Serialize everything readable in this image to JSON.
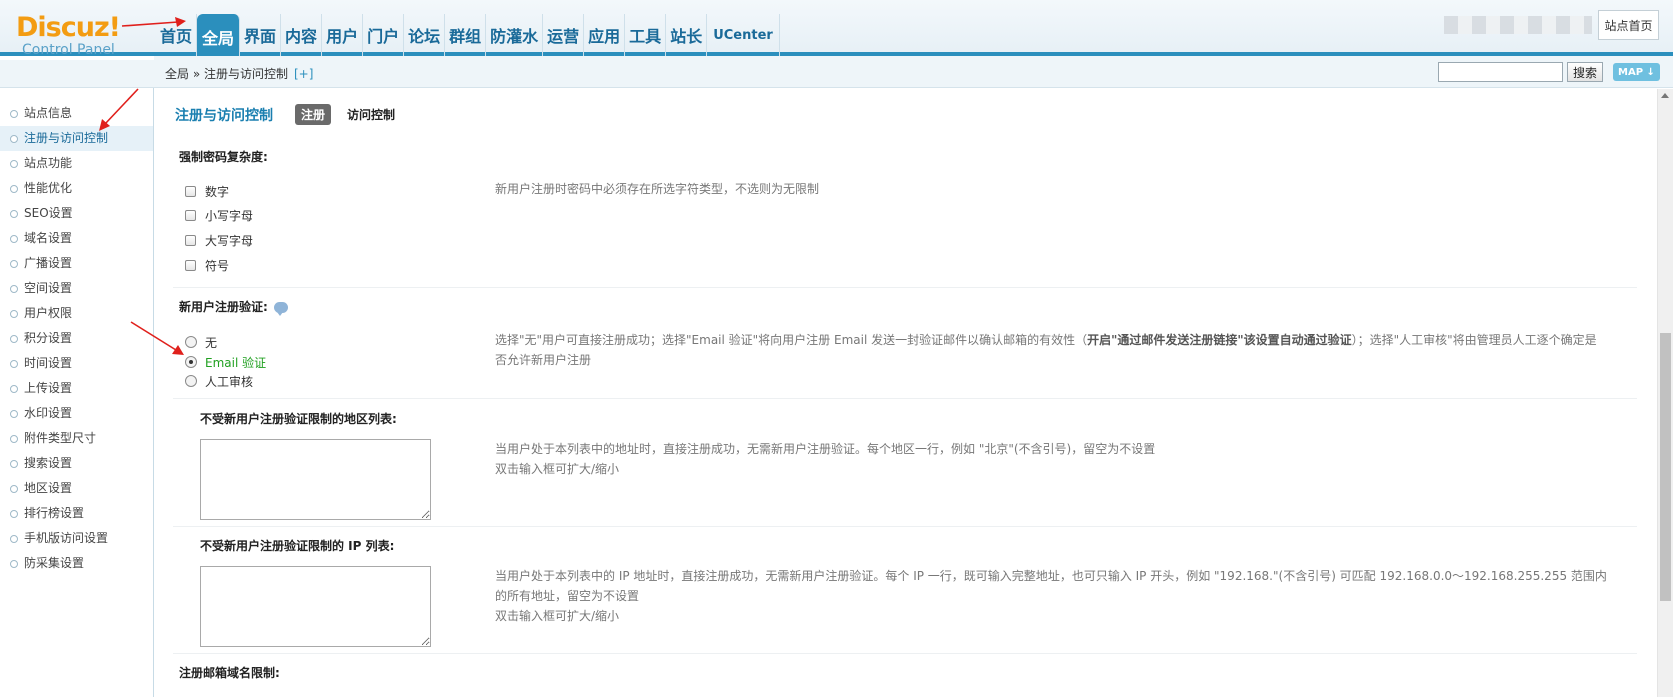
{
  "header": {
    "logo_brand": "Discuz!",
    "logo_sub": "Control Panel",
    "nav": [
      {
        "label": "首页"
      },
      {
        "label": "全局"
      },
      {
        "label": "界面"
      },
      {
        "label": "内容"
      },
      {
        "label": "用户"
      },
      {
        "label": "门户"
      },
      {
        "label": "论坛"
      },
      {
        "label": "群组"
      },
      {
        "label": "防灌水"
      },
      {
        "label": "运营"
      },
      {
        "label": "应用"
      },
      {
        "label": "工具"
      },
      {
        "label": "站长"
      },
      {
        "label": "UCenter"
      }
    ],
    "active_nav": "全局",
    "site_home_label": "站点首页"
  },
  "breadcrumb": {
    "path": "全局 » 注册与访问控制",
    "plus": "[+]"
  },
  "search": {
    "button_label": "搜索",
    "map_label": "MAP ↓"
  },
  "sidebar": {
    "items": [
      {
        "label": "站点信息"
      },
      {
        "label": "注册与访问控制"
      },
      {
        "label": "站点功能"
      },
      {
        "label": "性能优化"
      },
      {
        "label": "SEO设置"
      },
      {
        "label": "域名设置"
      },
      {
        "label": "广播设置"
      },
      {
        "label": "空间设置"
      },
      {
        "label": "用户权限"
      },
      {
        "label": "积分设置"
      },
      {
        "label": "时间设置"
      },
      {
        "label": "上传设置"
      },
      {
        "label": "水印设置"
      },
      {
        "label": "附件类型尺寸"
      },
      {
        "label": "搜索设置"
      },
      {
        "label": "地区设置"
      },
      {
        "label": "排行榜设置"
      },
      {
        "label": "手机版访问设置"
      },
      {
        "label": "防采集设置"
      }
    ],
    "active_item": "注册与访问控制"
  },
  "main": {
    "title": "注册与访问控制",
    "tabs": [
      {
        "label": "注册",
        "active": true
      },
      {
        "label": "访问控制",
        "active": false
      }
    ],
    "password": {
      "label": "强制密码复杂度:",
      "options": [
        "数字",
        "小写字母",
        "大写字母",
        "符号"
      ],
      "hint": "新用户注册时密码中必须存在所选字符类型，不选则为无限制"
    },
    "verify": {
      "label": "新用户注册验证:",
      "options": [
        "无",
        "Email 验证",
        "人工审核"
      ],
      "selected": "Email 验证",
      "hint_a": "选择\"无\"用户可直接注册成功；选择\"Email 验证\"将向用户注册 Email 发送一封验证邮件以确认邮箱的有效性（",
      "hint_bold": "开启\"通过邮件发送注册链接\"该设置自动通过验证",
      "hint_b": "）；选择\"人工审核\"将由管理员人工逐个确定是",
      "hint_line2": "否允许新用户注册"
    },
    "area_list": {
      "label": "不受新用户注册验证限制的地区列表:",
      "hint1": "当用户处于本列表中的地址时，直接注册成功，无需新用户注册验证。每个地区一行，例如 \"北京\"(不含引号)，留空为不设置",
      "hint2": "双击输入框可扩大/缩小"
    },
    "ip_list": {
      "label": "不受新用户注册验证限制的 IP 列表:",
      "hint1": "当用户处于本列表中的 IP 地址时，直接注册成功，无需新用户注册验证。每个 IP 一行，既可输入完整地址，也可只输入 IP 开头，例如 \"192.168.\"(不含引号) 可匹配 192.168.0.0～192.168.255.255 范围内",
      "hint1b": "的所有地址，留空为不设置",
      "hint2": "双击输入框可扩大/缩小"
    },
    "email_domain": {
      "label": "注册邮箱域名限制:"
    }
  },
  "colors": {
    "accent": "#2b8fbd",
    "arrow": "#e0201c",
    "logo": "#f39c12"
  }
}
